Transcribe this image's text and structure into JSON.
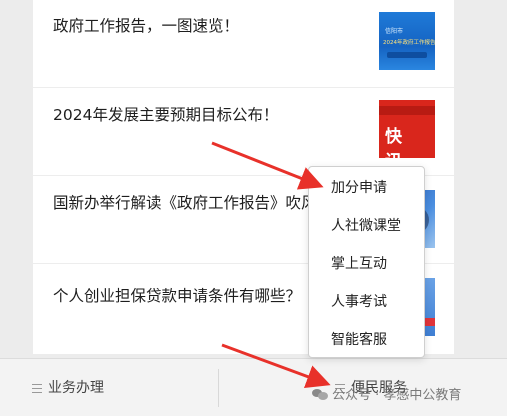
{
  "news": [
    {
      "title": "政府工作报告，一图速览！",
      "thumb_text_1": "信阳市",
      "thumb_text_2": "2024年政府工作报告"
    },
    {
      "title": "2024年发展主要预期目标公布！",
      "thumb_text": "快 讯"
    },
    {
      "title": "国新办举行解读《政府工作报告》吹风会"
    },
    {
      "title": "个人创业担保贷款申请条件有哪些？"
    }
  ],
  "popup_menu": {
    "items": [
      "加分申请",
      "人社微课堂",
      "掌上互动",
      "人事考试",
      "智能客服"
    ]
  },
  "tabbar": {
    "tabs": [
      "业务办理",
      "便民服务"
    ]
  },
  "watermark": "公众号 · 孝感中公教育",
  "colors": {
    "arrow": "#e8312a",
    "kuaixun_red": "#d9261c",
    "report_blue": "#1f7ad8"
  }
}
